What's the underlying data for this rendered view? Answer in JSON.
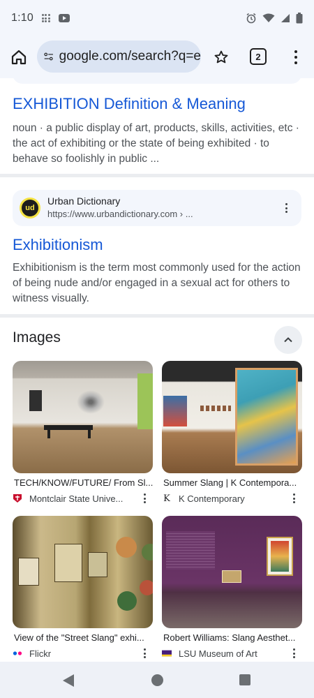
{
  "status_bar": {
    "time": "1:10",
    "icons": [
      "grid-dots-icon",
      "youtube-icon",
      "alarm-icon",
      "wifi-icon",
      "signal-icon",
      "battery-icon"
    ]
  },
  "browser": {
    "url": "google.com/search?q=e",
    "tab_count": "2",
    "icons": [
      "home-icon",
      "site-settings-icon",
      "star-icon",
      "tabs-icon",
      "more-vert-icon"
    ]
  },
  "results": [
    {
      "title": "EXHIBITION Definition & Meaning",
      "snippet": "noun · a public display of art, products, skills, activities, etc · the act of exhibiting or the state of being exhibited · to behave so foolishly in public ..."
    },
    {
      "source_name": "Urban Dictionary",
      "source_url": "https://www.urbandictionary.com › ...",
      "favicon_text": "ud",
      "title": "Exhibitionism",
      "snippet": "Exhibitionism is the term most commonly used for the action of being nude and/or engaged in a sexual act for others to witness visually."
    }
  ],
  "images_section": {
    "title": "Images",
    "items": [
      {
        "caption": "TECH/KNOW/FUTURE/ From Sl...",
        "source": "Montclair State Unive...",
        "icon": "montclair-icon"
      },
      {
        "caption": "Summer Slang | K Contempora...",
        "source": "K Contemporary",
        "icon": "k-contemporary-icon"
      },
      {
        "caption": "View of the \"Street Slang\" exhi...",
        "source": "Flickr",
        "icon": "flickr-icon"
      },
      {
        "caption": "Robert Williams: Slang Aesthet...",
        "source": "LSU Museum of Art",
        "icon": "lsu-icon"
      }
    ]
  },
  "colors": {
    "link": "#1558d6",
    "toolbar_bg": "#f3f6fc",
    "url_pill_bg": "#dbe4f3"
  }
}
